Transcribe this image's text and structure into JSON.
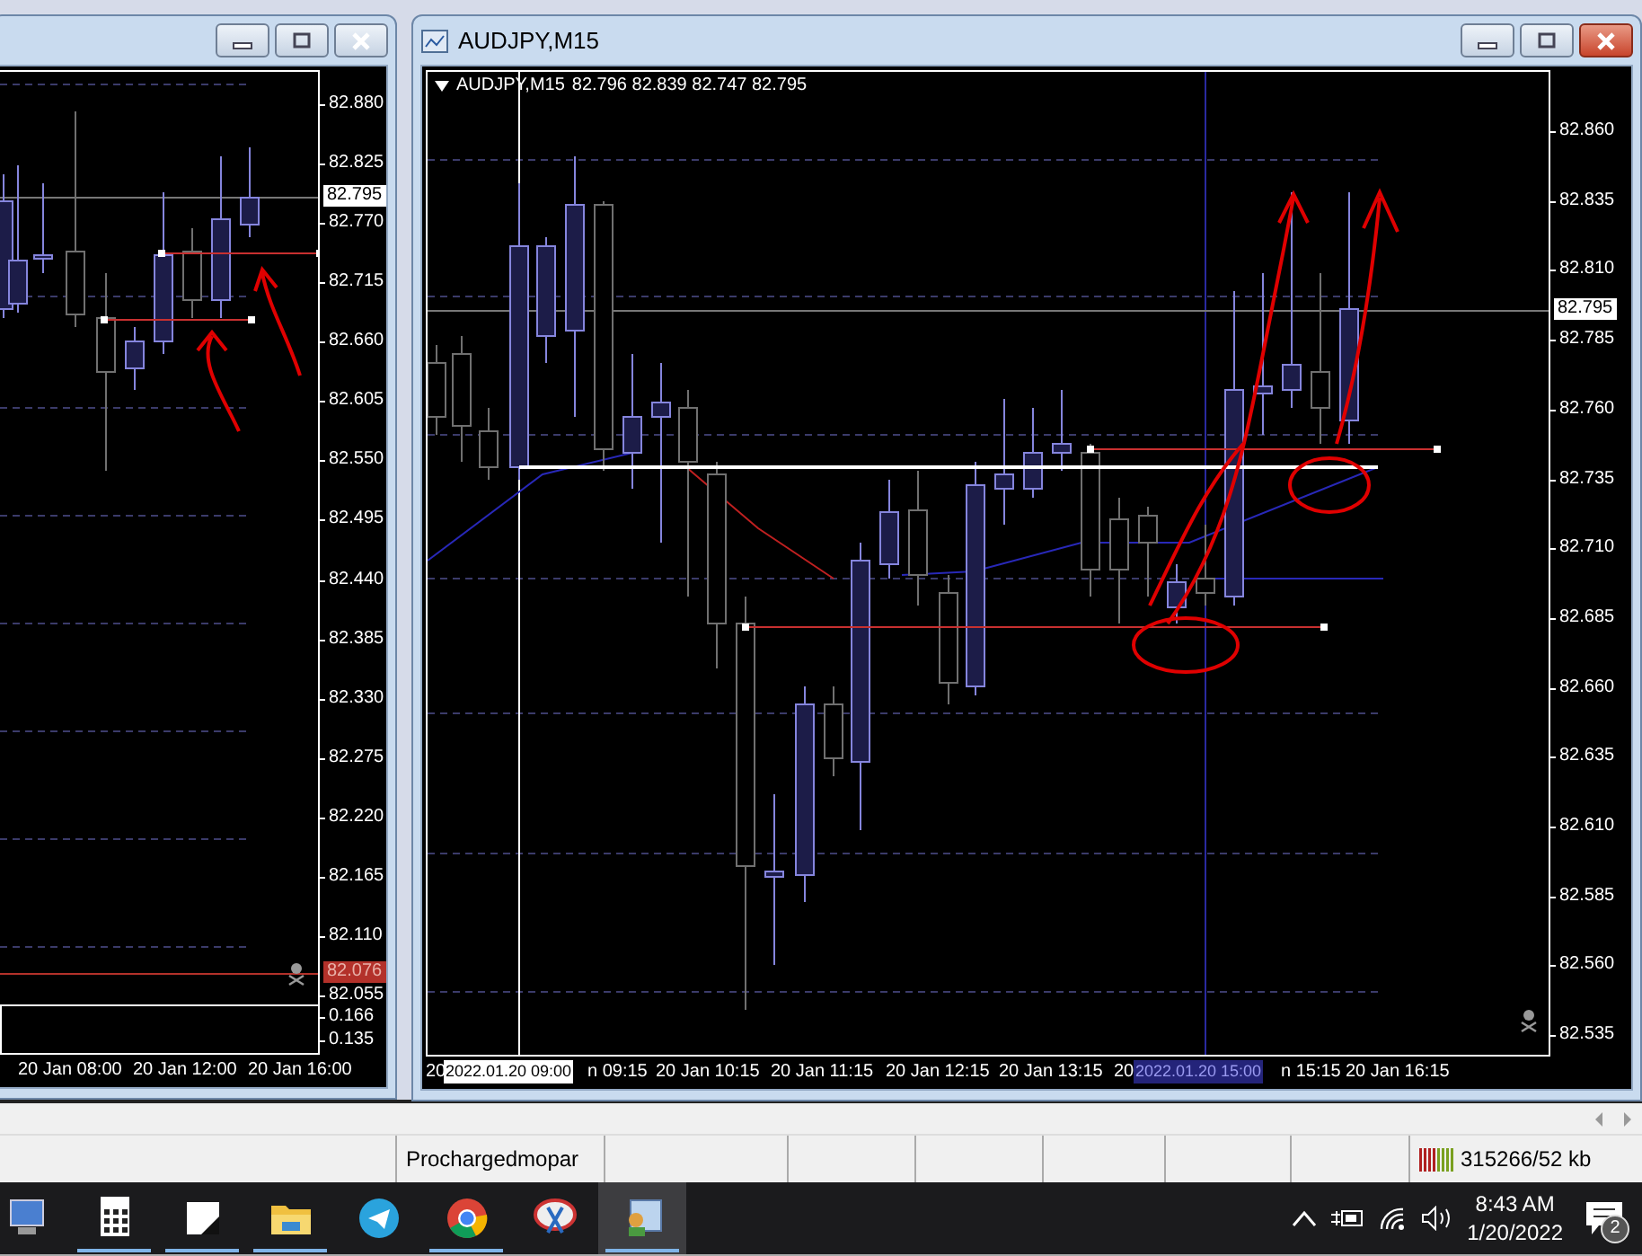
{
  "chart_windows": [
    {
      "active": false,
      "price_ticks": [
        "82.880",
        "82.825",
        "82.770",
        "82.715",
        "82.660",
        "82.605",
        "82.550",
        "82.495",
        "82.440",
        "82.385",
        "82.330",
        "82.275",
        "82.220",
        "82.165",
        "82.110",
        "82.055"
      ],
      "current_price": "82.795",
      "alert_price": "82.076",
      "indicator_ticks": [
        "0.166",
        "0.135"
      ],
      "time_labels": [
        "20 Jan 08:00",
        "20 Jan 12:00",
        "20 Jan 16:00"
      ]
    },
    {
      "active": true,
      "title": "AUDJPY,M15",
      "header": {
        "symbol": "AUDJPY,M15",
        "ohlc": "82.796 82.839 82.747 82.795"
      },
      "price_ticks": [
        "82.860",
        "82.835",
        "82.810",
        "82.785",
        "82.760",
        "82.735",
        "82.710",
        "82.685",
        "82.660",
        "82.635",
        "82.610",
        "82.585",
        "82.560",
        "82.535"
      ],
      "current_price": "82.795",
      "time_labels": [
        "20",
        "n 09:15",
        "20 Jan 10:15",
        "20 Jan 11:15",
        "20 Jan 12:15",
        "20 Jan 13:15",
        "20",
        "n 15:15",
        "20 Jan 16:15"
      ],
      "crosshair_times": [
        {
          "text": "2022.01.20 09:00",
          "kind": "plain"
        },
        {
          "text": "2022.01.20 15:00",
          "kind": "highlight"
        }
      ]
    }
  ],
  "status_bar": {
    "segments": [
      "Prochargedmopar"
    ],
    "traffic": "315266/52 kb"
  },
  "taskbar": {
    "apps": [
      {
        "kind": "computer",
        "running": false,
        "selected": false
      },
      {
        "kind": "calculator",
        "running": true,
        "selected": false
      },
      {
        "kind": "notes",
        "running": true,
        "selected": false
      },
      {
        "kind": "folder",
        "running": true,
        "selected": false
      },
      {
        "kind": "telegram",
        "running": false,
        "selected": false
      },
      {
        "kind": "chrome",
        "running": true,
        "selected": false
      },
      {
        "kind": "snipping",
        "running": false,
        "selected": false
      },
      {
        "kind": "terminal",
        "running": true,
        "selected": true
      }
    ],
    "clock": {
      "time": "8:43 AM",
      "date": "1/20/2022"
    },
    "notifications": "2"
  }
}
